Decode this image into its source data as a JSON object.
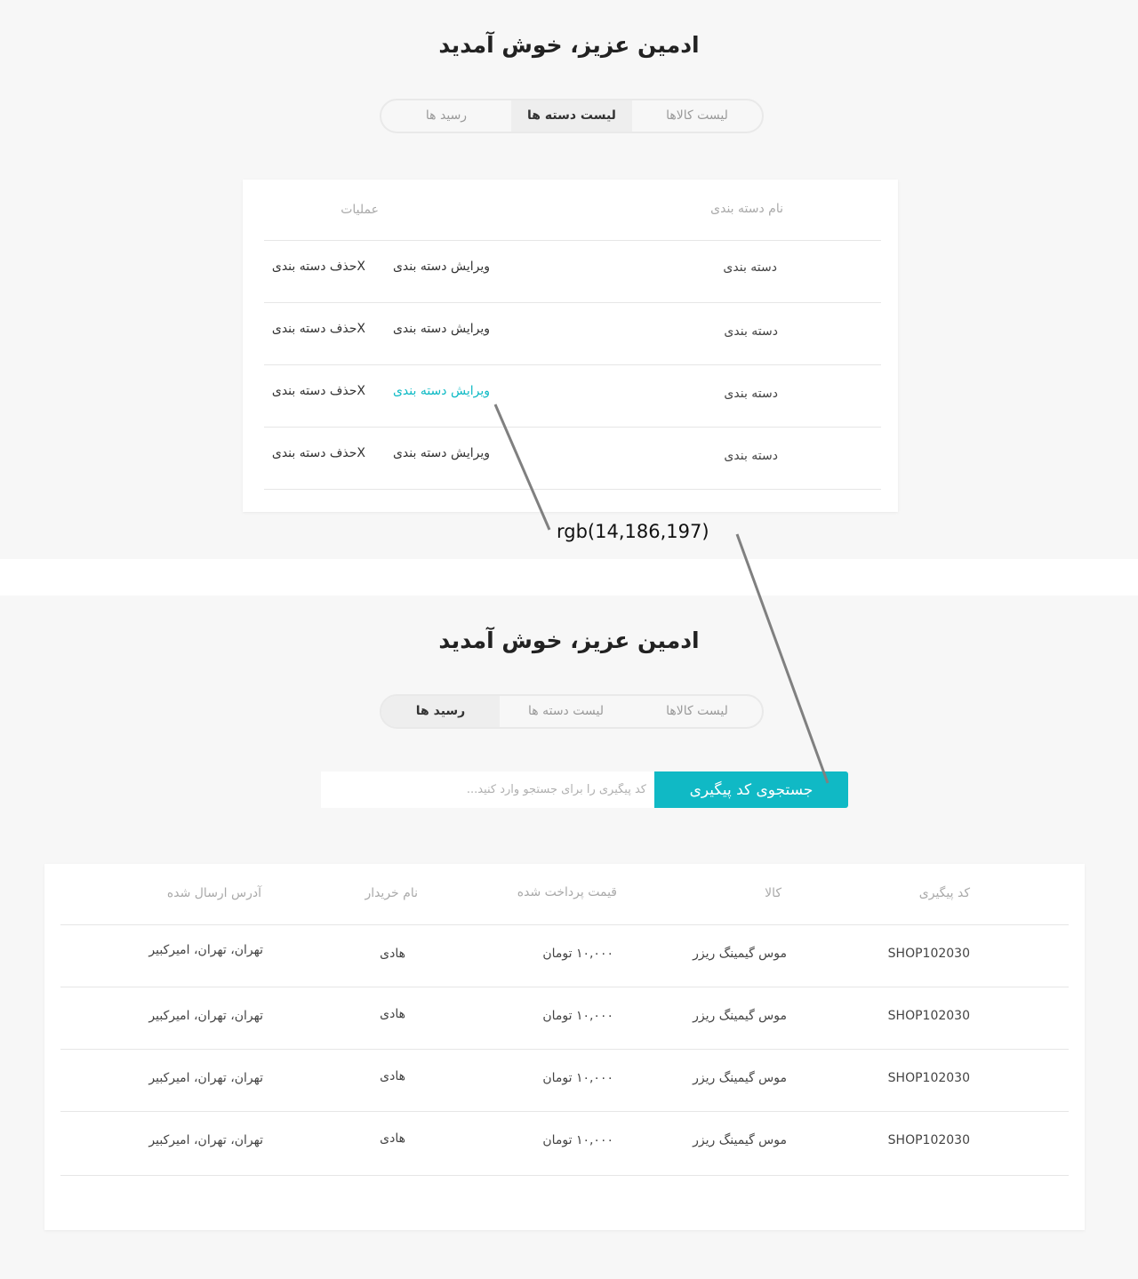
{
  "top_screen": {
    "welcome": "ادمین عزیز، خوش آمدید",
    "tabs": [
      {
        "label": "لیست کالاها",
        "active": false
      },
      {
        "label": "لیست دسته ها",
        "active": true
      },
      {
        "label": "رسید ها",
        "active": false
      }
    ],
    "table": {
      "headers": {
        "name": "نام دسته بندی",
        "actions": "عملیات"
      },
      "rows": [
        {
          "name": "دسته بندی",
          "edit": "ویرایش دسته بندی",
          "delete": "Xحذف دسته بندی",
          "hover": false
        },
        {
          "name": "دسته بندی",
          "edit": "ویرایش دسته بندی",
          "delete": "Xحذف دسته بندی",
          "hover": false
        },
        {
          "name": "دسته بندی",
          "edit": "ویرایش دسته بندی",
          "delete": "Xحذف دسته بندی",
          "hover": true
        },
        {
          "name": "دسته بندی",
          "edit": "ویرایش دسته بندی",
          "delete": "Xحذف دسته بندی",
          "hover": false
        }
      ]
    }
  },
  "annotation": {
    "label": "rgb(14,186,197)",
    "color": "#0ebac5"
  },
  "bottom_screen": {
    "welcome": "ادمین عزیز، خوش آمدید",
    "tabs": [
      {
        "label": "لیست کالاها",
        "active": false
      },
      {
        "label": "لیست دسته ها",
        "active": false
      },
      {
        "label": "رسید ها",
        "active": true
      }
    ],
    "search": {
      "placeholder": "کد پیگیری را برای جستجو وارد کنید...",
      "button_label": "جستجوی کد پیگیری"
    },
    "table": {
      "headers": {
        "code": "کد پیگیری",
        "product": "کالا",
        "price": "قیمت پرداخت شده",
        "buyer": "نام خریدار",
        "address": "آدرس ارسال شده"
      },
      "rows": [
        {
          "code": "SHOP102030",
          "product": "موس گیمینگ ریزر",
          "price": "۱۰,۰۰۰ تومان",
          "buyer": "هادی",
          "address": "تهران، تهران، امیرکبیر"
        },
        {
          "code": "SHOP102030",
          "product": "موس گیمینگ ریزر",
          "price": "۱۰,۰۰۰ تومان",
          "buyer": "هادی",
          "address": "تهران، تهران، امیرکبیر"
        },
        {
          "code": "SHOP102030",
          "product": "موس گیمینگ ریزر",
          "price": "۱۰,۰۰۰ تومان",
          "buyer": "هادی",
          "address": "تهران، تهران، امیرکبیر"
        },
        {
          "code": "SHOP102030",
          "product": "موس گیمینگ ریزر",
          "price": "۱۰,۰۰۰ تومان",
          "buyer": "هادی",
          "address": "تهران، تهران، امیرکبیر"
        }
      ]
    }
  }
}
